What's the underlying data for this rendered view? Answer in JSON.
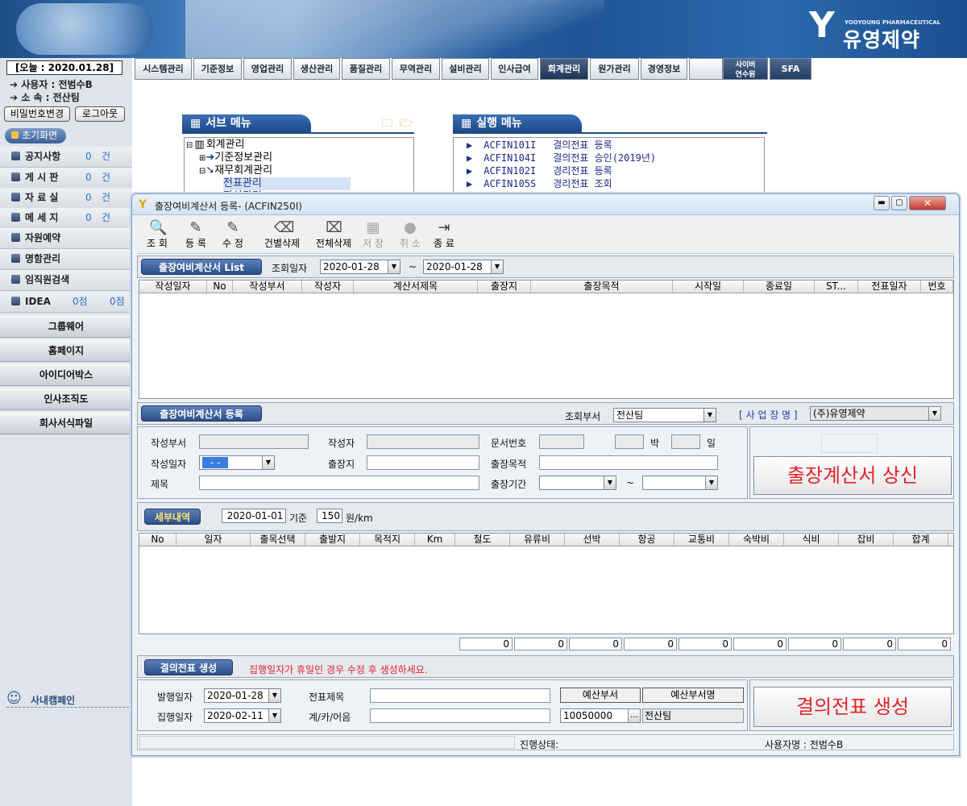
{
  "banner": {
    "logo_mark": "Y",
    "logo_sub": "YOOYOUNG PHARMACEUTICAL",
    "logo_name": "유영제약"
  },
  "left": {
    "date": "[오늘 : 2020.01.28]",
    "user_line": "➔ 사용자 : 전범수B",
    "dept_line": "➔ 소   속 : 전산팀",
    "pw_button": "비밀번호변경",
    "logout_button": "로그아웃",
    "home": "초기화면",
    "items": [
      {
        "label": "공지사항",
        "count": "0",
        "unit": "건"
      },
      {
        "label": "게 시 판",
        "count": "0",
        "unit": "건"
      },
      {
        "label": "자 료 실",
        "count": "0",
        "unit": "건"
      },
      {
        "label": "메 세 지",
        "count": "0",
        "unit": "건"
      },
      {
        "label": "자원예약",
        "count": "",
        "unit": ""
      },
      {
        "label": "명함관리",
        "count": "",
        "unit": ""
      },
      {
        "label": "임직원검색",
        "count": "",
        "unit": ""
      },
      {
        "label": "IDEA",
        "count": "0점",
        "unit": "0점"
      }
    ],
    "groups": [
      "그룹웨어",
      "홈페이지",
      "아이디어박스",
      "인사조직도",
      "회사서식파일"
    ],
    "campaign": "사내캠페인"
  },
  "nav": {
    "tabs": [
      "시스템관리",
      "기준정보",
      "영업관리",
      "생산관리",
      "품질관리",
      "무역관리",
      "설비관리",
      "인사급여",
      "회계관리",
      "원가관리",
      "경영정보"
    ],
    "cyber": "사이버\n연수원",
    "sfa": "SFA",
    "active": "회계관리"
  },
  "submenu": {
    "title": "서브 메뉴",
    "tree": [
      "회계관리",
      "기준정보관리",
      "재무회계관리",
      "전표관리",
      "자산관리"
    ]
  },
  "runmenu": {
    "title": "실행 메뉴",
    "items": [
      {
        "code": "ACFIN101I",
        "name": "결의전표 등록"
      },
      {
        "code": "ACFIN104I",
        "name": "결의전표 승인(2019년)"
      },
      {
        "code": "ACFIN102I",
        "name": "경리전표 등록"
      },
      {
        "code": "ACFIN105S",
        "name": "경리전표 조회"
      }
    ]
  },
  "window": {
    "title": "출장여비계산서 등록- (ACFIN250I)",
    "toolbar": [
      {
        "label": "조 회",
        "icon": "search-icon",
        "enabled": true
      },
      {
        "label": "등 록",
        "icon": "pencil-icon",
        "enabled": true
      },
      {
        "label": "수 정",
        "icon": "pencil-icon",
        "enabled": true
      },
      {
        "label": "건별삭제",
        "icon": "delete-icon",
        "enabled": true
      },
      {
        "label": "전체삭제",
        "icon": "delete-all-icon",
        "enabled": true
      },
      {
        "label": "저 장",
        "icon": "save-icon",
        "enabled": false
      },
      {
        "label": "취 소",
        "icon": "cancel-icon",
        "enabled": false
      },
      {
        "label": "종 료",
        "icon": "exit-icon",
        "enabled": true
      }
    ],
    "list": {
      "title": "출장여비계산서 List",
      "query_label": "조회일자",
      "date_from": "2020-01-28",
      "tilde": "~",
      "date_to": "2020-01-28",
      "columns": [
        "작성일자",
        "No",
        "작성부서",
        "작성자",
        "계산서제목",
        "출장지",
        "출장목적",
        "시작일",
        "종료일",
        "ST...",
        "전표일자",
        "번호"
      ]
    },
    "register": {
      "title": "출장여비계산서 등록",
      "dept_label": "조회부서",
      "dept_value": "전산팀",
      "biz_label": "[ 사 업 장 명 ]",
      "biz_value": "(주)유영제약",
      "fields": {
        "dept": "작성부서",
        "writer": "작성자",
        "docno": "문서번호",
        "nights": "박",
        "days": "일",
        "date": "작성일자",
        "date_value": "  -  -",
        "place": "출장지",
        "purpose": "출장목적",
        "subject": "제목",
        "period": "출장기간",
        "tilde": "~"
      },
      "submit": "출장계산서 상신"
    },
    "detail": {
      "title": "세부내역",
      "base_date": "2020-01-01",
      "base_label": "기준",
      "rate": "150",
      "rate_unit": "원/km",
      "columns": [
        "No",
        "일자",
        "출목선택",
        "출발지",
        "목적지",
        "Km",
        "철도",
        "유류비",
        "선박",
        "항공",
        "교통비",
        "숙박비",
        "식비",
        "잡비",
        "합계"
      ],
      "sums": [
        "0",
        "0",
        "0",
        "0",
        "0",
        "0",
        "0",
        "0",
        "0"
      ]
    },
    "voucher": {
      "title": "결의전표 생성",
      "notice": "집행일자가 휴일인 경우 수정 후 생성하세요.",
      "issue_label": "발행일자",
      "issue_date": "2020-01-28",
      "exec_label": "집행일자",
      "exec_date": "2020-02-11",
      "subject_label": "전표제목",
      "account_label": "계/카/어음",
      "budget_dept_btn": "예산부서",
      "budget_dept_name_btn": "예산부서명",
      "budget_code": "10050000",
      "budget_name": "전산팀",
      "create": "결의전표 생성"
    },
    "status": {
      "progress": "진행상태:",
      "user": "사용자명 : 전범수B"
    }
  },
  "colors": {
    "accent": "#1d4a8a",
    "danger": "#e0242b",
    "link": "#2a6fc9"
  }
}
